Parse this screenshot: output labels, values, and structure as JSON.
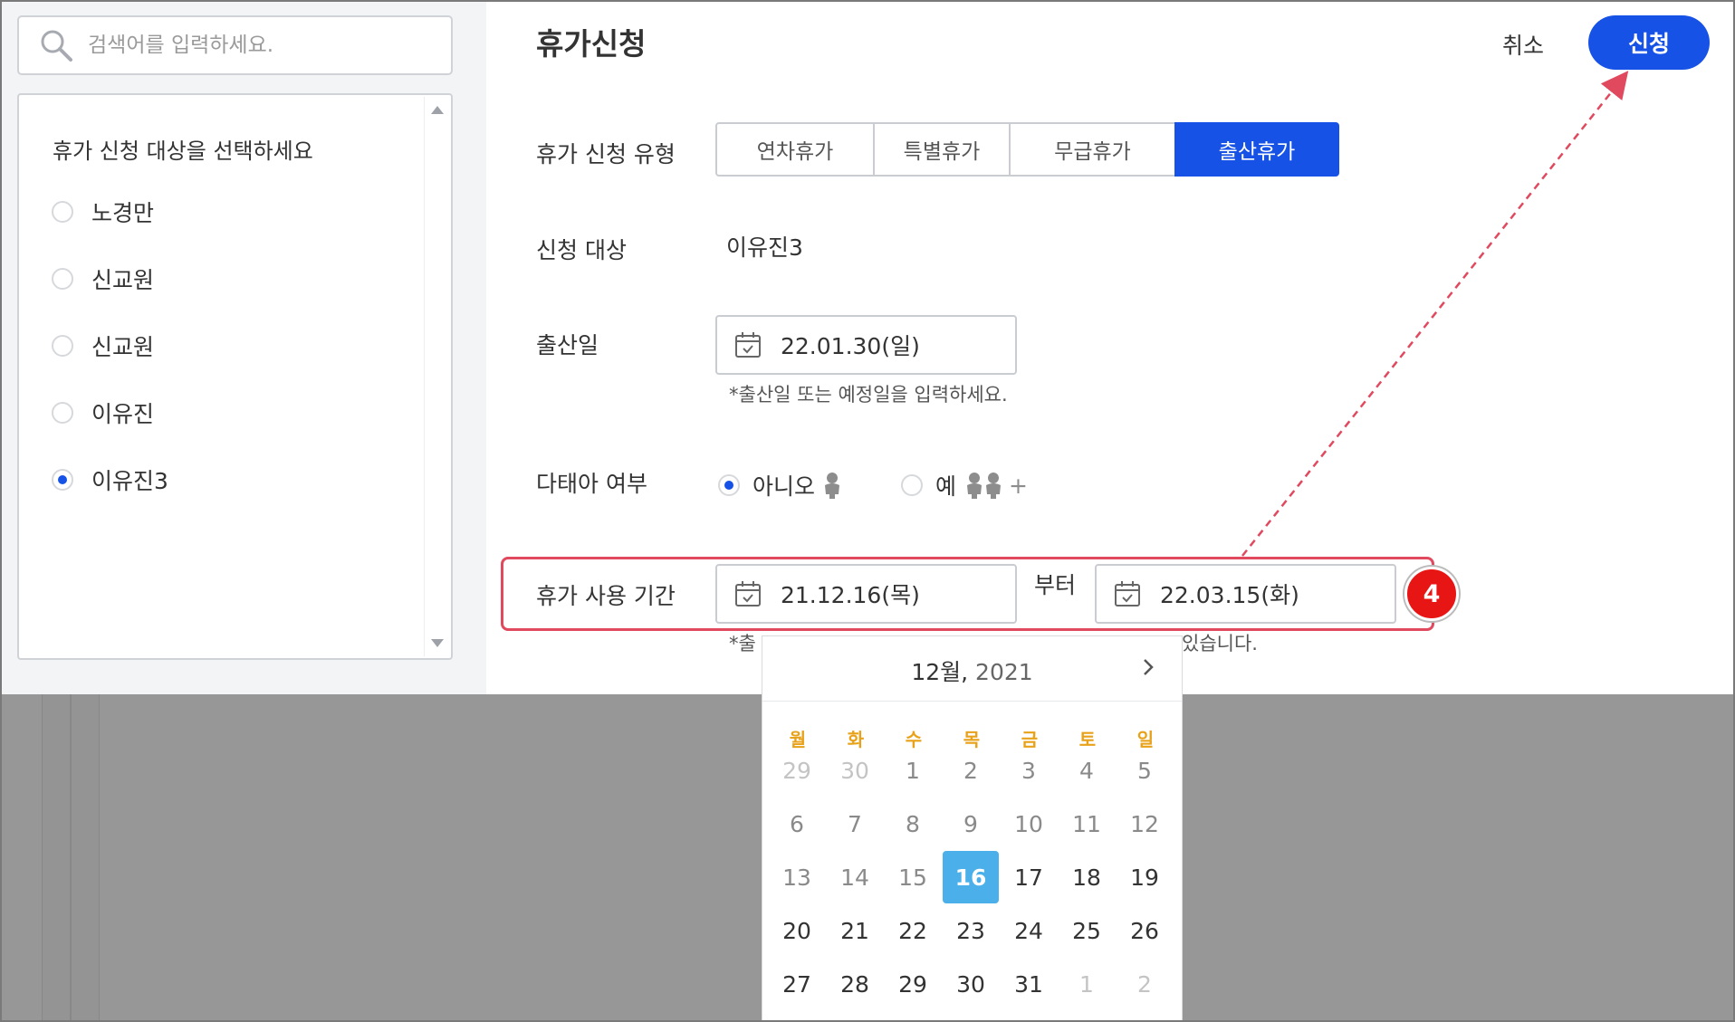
{
  "search": {
    "placeholder": "검색어를 입력하세요."
  },
  "target_list": {
    "title": "휴가 신청 대상을 선택하세요",
    "items": [
      {
        "label": "노경만",
        "selected": false
      },
      {
        "label": "신교원",
        "selected": false
      },
      {
        "label": "신교원",
        "selected": false
      },
      {
        "label": "이유진",
        "selected": false
      },
      {
        "label": "이유진3",
        "selected": true
      }
    ]
  },
  "header": {
    "title": "휴가신청",
    "cancel_label": "취소",
    "submit_label": "신청"
  },
  "form": {
    "type_label": "휴가 신청 유형",
    "types": [
      {
        "label": "연차휴가",
        "active": false
      },
      {
        "label": "특별휴가",
        "active": false
      },
      {
        "label": "무급휴가",
        "active": false
      },
      {
        "label": "출산휴가",
        "active": true
      }
    ],
    "target_label": "신청 대상",
    "target_value": "이유진3",
    "birth_label": "출산일",
    "birth_value": "22.01.30(일)",
    "birth_hint": "*출산일 또는 예정일을 입력하세요.",
    "multiple_label": "다태아 여부",
    "multiple_no": "아니오",
    "multiple_yes": "예",
    "multiple_plus": "+",
    "period_label": "휴가 사용 기간",
    "period_start": "21.12.16(목)",
    "period_from": "부터",
    "period_end": "22.03.15(화)",
    "period_hint_left": "*출",
    "period_hint_right": "있습니다."
  },
  "annotation": {
    "step": "4",
    "color": "#e81515"
  },
  "calendar": {
    "month": "12월,",
    "year": "2021",
    "weekdays": [
      "월",
      "화",
      "수",
      "목",
      "금",
      "토",
      "일"
    ],
    "weeks": [
      [
        {
          "d": "29",
          "s": "muted"
        },
        {
          "d": "30",
          "s": "muted"
        },
        {
          "d": "1",
          "s": "past"
        },
        {
          "d": "2",
          "s": "past"
        },
        {
          "d": "3",
          "s": "past"
        },
        {
          "d": "4",
          "s": "past"
        },
        {
          "d": "5",
          "s": "past"
        }
      ],
      [
        {
          "d": "6",
          "s": "past"
        },
        {
          "d": "7",
          "s": "past"
        },
        {
          "d": "8",
          "s": "past"
        },
        {
          "d": "9",
          "s": "past"
        },
        {
          "d": "10",
          "s": "past"
        },
        {
          "d": "11",
          "s": "past"
        },
        {
          "d": "12",
          "s": "past"
        }
      ],
      [
        {
          "d": "13",
          "s": "past"
        },
        {
          "d": "14",
          "s": "past"
        },
        {
          "d": "15",
          "s": "past"
        },
        {
          "d": "16",
          "s": "selected"
        },
        {
          "d": "17",
          "s": "normal"
        },
        {
          "d": "18",
          "s": "normal"
        },
        {
          "d": "19",
          "s": "normal"
        }
      ],
      [
        {
          "d": "20",
          "s": "normal"
        },
        {
          "d": "21",
          "s": "normal"
        },
        {
          "d": "22",
          "s": "normal"
        },
        {
          "d": "23",
          "s": "normal"
        },
        {
          "d": "24",
          "s": "normal"
        },
        {
          "d": "25",
          "s": "normal"
        },
        {
          "d": "26",
          "s": "normal"
        }
      ],
      [
        {
          "d": "27",
          "s": "normal"
        },
        {
          "d": "28",
          "s": "normal"
        },
        {
          "d": "29",
          "s": "normal"
        },
        {
          "d": "30",
          "s": "normal"
        },
        {
          "d": "31",
          "s": "normal"
        },
        {
          "d": "1",
          "s": "muted"
        },
        {
          "d": "2",
          "s": "muted"
        }
      ]
    ]
  },
  "colors": {
    "accent": "#1652e6",
    "selected_day": "#4bafe9",
    "weekday": "#e8a21a",
    "highlight": "#e0495e"
  }
}
